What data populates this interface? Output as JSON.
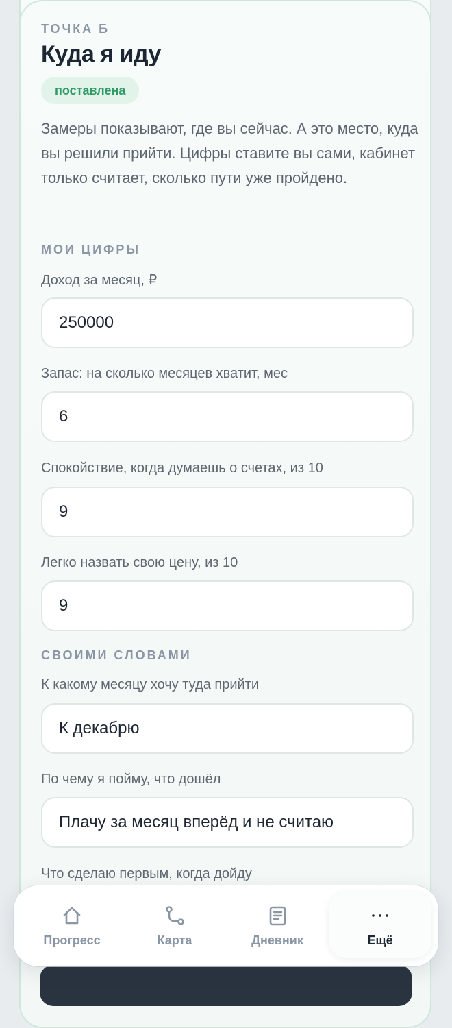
{
  "card": {
    "eyebrow": "ТОЧКА Б",
    "title": "Куда я иду",
    "badge": "поставлена",
    "description": "Замеры показывают, где вы сейчас. А это место, куда вы решили прийти. Цифры ставите вы сами, кабинет только считает, сколько пути уже пройдено."
  },
  "numbers_section": {
    "heading": "МОИ ЦИФРЫ",
    "fields": [
      {
        "label": "Доход за месяц, ₽",
        "value": "250000"
      },
      {
        "label": "Запас: на сколько месяцев хватит, мес",
        "value": "6"
      },
      {
        "label": "Спокойствие, когда думаешь о счетах, из 10",
        "value": "9"
      },
      {
        "label": "Легко назвать свою цену, из 10",
        "value": "9"
      }
    ]
  },
  "words_section": {
    "heading": "СВОИМИ СЛОВАМИ",
    "fields": [
      {
        "label": "К какому месяцу хочу туда прийти",
        "value": "К декабрю"
      },
      {
        "label": "По чему я пойму, что дошёл",
        "value": "Плачу за месяц вперёд и не считаю"
      },
      {
        "label": "Что сделаю первым, когда дойду",
        "value": ""
      }
    ]
  },
  "nav": {
    "items": [
      {
        "label": "Прогресс",
        "icon": "home-icon"
      },
      {
        "label": "Карта",
        "icon": "route-icon"
      },
      {
        "label": "Дневник",
        "icon": "journal-icon"
      },
      {
        "label": "Ещё",
        "icon": "more-icon",
        "active": true
      }
    ]
  },
  "colors": {
    "accent_green": "#2f9a66",
    "badge_bg": "#e2f3ea",
    "muted_text": "#8a96a3",
    "dark_text": "#1d2633"
  }
}
